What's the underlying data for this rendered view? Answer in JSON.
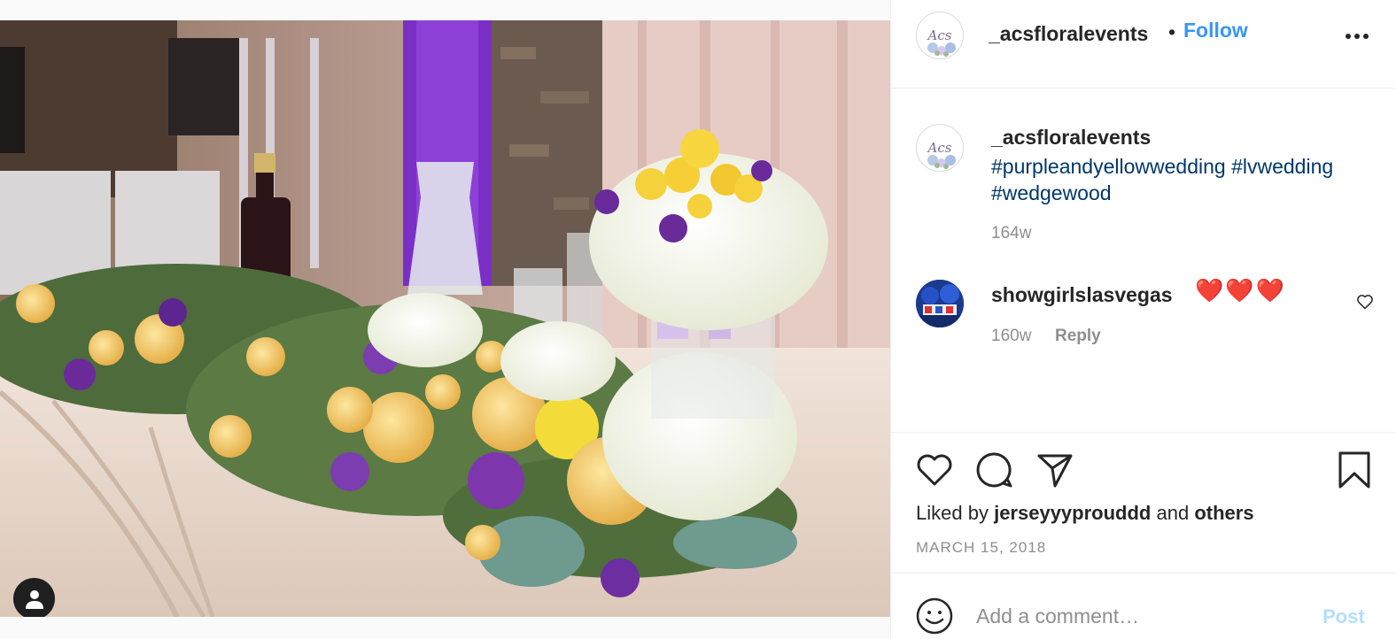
{
  "photo": {
    "alt_subject": "floral arrangement",
    "tag_icon": "user-icon"
  },
  "post": {
    "username": "_acsfloralevents",
    "dot": "•",
    "follow_label": "Follow",
    "more_icon": "more-options-icon",
    "avatar_logo_text": "Acs"
  },
  "caption": {
    "username": "_acsfloralevents",
    "text": "#purpleandyellowwedding #lvwedding #wedgewood",
    "time": "164w"
  },
  "comment": {
    "username": "showgirlslasvegas",
    "text": "❤️❤️❤️",
    "time": "160w",
    "reply_label": "Reply",
    "like_icon": "heart-outline-icon"
  },
  "actions": {
    "liked_by_prefix": "Liked by",
    "liked_by_user": "jerseyyyprouddd",
    "liked_by_and": "and",
    "liked_by_others": "others",
    "date": "MARCH 15, 2018"
  },
  "add_comment": {
    "placeholder": "Add a comment…",
    "post_label": "Post",
    "emoji_icon": "emoji-icon"
  },
  "colors": {
    "link_blue": "#3897f0",
    "hashtag": "#00376b",
    "muted": "#8e8e8e",
    "post_disabled": "#b2dffc"
  }
}
